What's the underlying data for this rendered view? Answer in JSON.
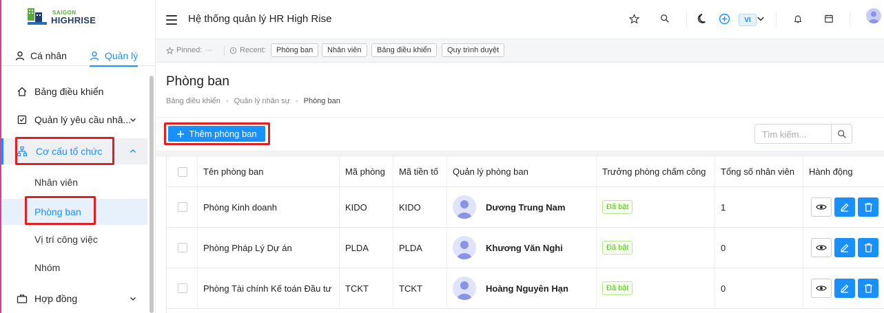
{
  "brand": {
    "top": "SAIGON",
    "main": "HIGHRISE"
  },
  "sidebar": {
    "tabs": [
      {
        "label": "Cá nhân"
      },
      {
        "label": "Quản lý"
      }
    ],
    "items": [
      {
        "label": "Bảng điều khiển"
      },
      {
        "label": "Quản lý yêu cầu nhâ..."
      },
      {
        "label": "Cơ cấu tổ chức"
      },
      {
        "label": "Hợp đồng"
      }
    ],
    "submenu": [
      {
        "label": "Nhân viên"
      },
      {
        "label": "Phòng ban"
      },
      {
        "label": "Vị trí công việc"
      },
      {
        "label": "Nhóm"
      }
    ]
  },
  "header": {
    "title": "Hệ thống quản lý HR High Rise",
    "lang": "VI"
  },
  "pinbar": {
    "pinned_label": "Pinned:",
    "pinned_value": "---",
    "recent_label": "Recent:",
    "chips": [
      "Phòng ban",
      "Nhân viên",
      "Bảng điều khiển",
      "Quy trình duyệt"
    ]
  },
  "page": {
    "title": "Phòng ban",
    "breadcrumb": [
      "Bảng điều khiển",
      "-",
      "Quản lý nhân sự",
      "-",
      "Phòng ban"
    ],
    "add_button": "Thêm phòng ban",
    "search_placeholder": "Tìm kiếm..."
  },
  "table": {
    "columns": [
      "Tên phòng ban",
      "Mã phòng",
      "Mã tiền tố",
      "Quản lý phòng ban",
      "Trưởng phòng chấm công",
      "Tổng số nhân viên",
      "Hành động"
    ],
    "rows": [
      {
        "name": "Phòng Kinh doanh",
        "code": "KIDO",
        "prefix": "KIDO",
        "manager": "Dương Trung Nam",
        "status": "Đã bật",
        "count": "1"
      },
      {
        "name": "Phòng Pháp Lý Dự án",
        "code": "PLDA",
        "prefix": "PLDA",
        "manager": "Khương Văn Nghi",
        "status": "Đã bật",
        "count": "0"
      },
      {
        "name": "Phòng Tài chính Kế toán Đầu tư",
        "code": "TCKT",
        "prefix": "TCKT",
        "manager": "Hoàng Nguyên Hạn",
        "status": "Đã bật",
        "count": "0"
      }
    ]
  },
  "colors": {
    "accent": "#1890ff",
    "highlight": "#e02020",
    "success": "#52c41a"
  }
}
